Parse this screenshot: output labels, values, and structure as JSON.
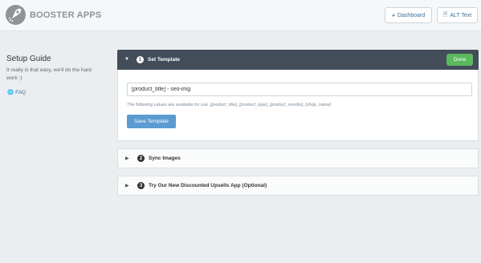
{
  "header": {
    "brand": "BOOSTER APPS",
    "dashboard_label": "Dashboard",
    "alt_text_label": "ALT Text",
    "dashboard_icon": "gauge-icon",
    "alt_text_icon": "document-icon"
  },
  "sidebar": {
    "title": "Setup Guide",
    "description": "It really is that easy, we'll do the hard work :)",
    "faq_label": "FAQ",
    "faq_icon": "globe-icon"
  },
  "steps": [
    {
      "number": "1",
      "title": "Set Template",
      "expanded": true,
      "done_label": "Done",
      "template_value": "[product_title] - seo-img",
      "help_text": "The following values are available for use. [product_title], [product_type], [product_vendor], [shop_name]",
      "save_label": "Save Template"
    },
    {
      "number": "2",
      "title": "Sync Images",
      "expanded": false
    },
    {
      "number": "3",
      "title": "Try Our New Discounted Upsells App (Optional)",
      "expanded": false
    }
  ],
  "colors": {
    "header_dark": "#434d5a",
    "done_green": "#5cb85c",
    "save_blue": "#5b9bd1",
    "link_blue": "#3a6f96",
    "background": "#ebeef0"
  }
}
